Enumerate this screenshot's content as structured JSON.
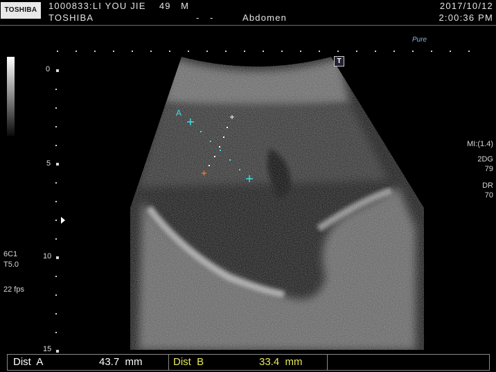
{
  "header": {
    "logo": "TOSHIBA",
    "patient_line": "1000833:LI YOU JIE    49   M",
    "system_line": "TOSHIBA",
    "exam_placeholder": "-   -",
    "region": "Abdomen",
    "date": "2017/10/12",
    "time": "2:00:36 PM"
  },
  "image": {
    "apure_label": "Pure",
    "focus_marker": "T",
    "measure_letter_a": "A"
  },
  "depth_scale": [
    "0",
    "5",
    "10",
    "15"
  ],
  "right_params": {
    "mi": "MI:(1.4)",
    "gain_label": "2DG",
    "gain_value": "79",
    "dr_label": "DR",
    "dr_value": "70"
  },
  "left_params": {
    "probe": "6C1",
    "preset": "T5.0",
    "frame_rate": "22 fps"
  },
  "footer": {
    "dist_a_label": "Dist  A",
    "dist_a_value": "43.7  mm",
    "dist_b_label": "Dist  B",
    "dist_b_value": "33.4  mm"
  },
  "colors": {
    "dist_a": "#ffffff",
    "dist_b": "#e8e85a",
    "caliper_a": "#3fe0e6",
    "caliper_b": "#ffffff",
    "caliper_b_end": "#ff7a2a"
  }
}
